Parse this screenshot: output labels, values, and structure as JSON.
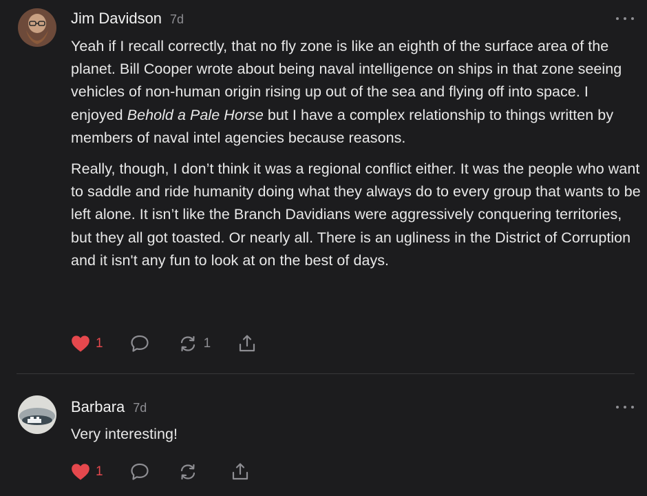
{
  "comments": [
    {
      "author": "Jim Davidson",
      "time": "7d",
      "paragraph_1_before": "Yeah if I recall correctly, that no fly zone is like an eighth of the surface area of the planet. Bill Cooper wrote about being naval intelligence on ships in that zone seeing vehicles of non-human origin rising up out of the sea and flying off into space. I enjoyed ",
      "paragraph_1_italic": "Behold a Pale Horse",
      "paragraph_1_after": " but I have a complex relationship to things written by members of naval intel agencies because reasons.",
      "paragraph_2": "Really, though, I don’t think it was a regional conflict either. It was the people who want to saddle and ride humanity doing what they always do to every group that wants to be left alone. It isn’t like the Branch Davidians were aggressively conquering territories, but they all got toasted. Or nearly all. There is an ugliness in the District of Corruption and it isn't any fun to look at on the best of days.",
      "likes": "1",
      "restacks": "1",
      "liked": true
    },
    {
      "author": "Barbara",
      "time": "7d",
      "text": "Very interesting!",
      "likes": "1",
      "liked": true
    }
  ],
  "icons": {
    "more": "more-horizontal-icon",
    "like": "heart-icon",
    "reply": "speech-bubble-icon",
    "restack": "restack-arrows-icon",
    "share": "share-upload-icon"
  },
  "colors": {
    "background": "#1c1c1e",
    "like_active": "#e5484d",
    "muted": "#8e8e93"
  }
}
